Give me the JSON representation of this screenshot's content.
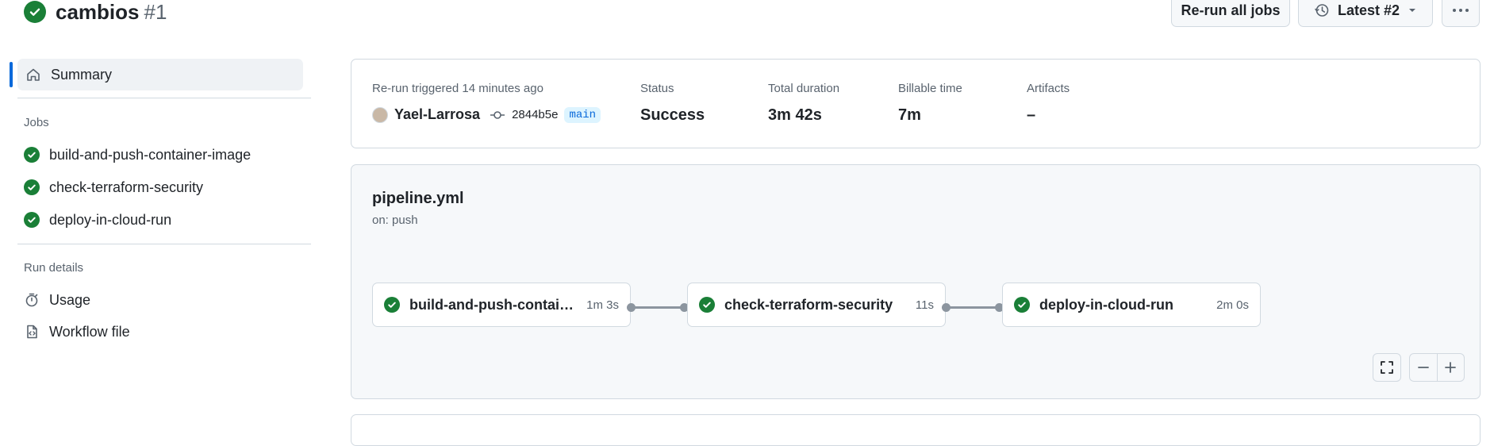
{
  "header": {
    "title": "cambios",
    "run_number": "#1",
    "rerun_label": "Re-run all jobs",
    "latest_label": "Latest #2"
  },
  "sidebar": {
    "summary_label": "Summary",
    "jobs_heading": "Jobs",
    "jobs": [
      {
        "label": "build-and-push-container-image"
      },
      {
        "label": "check-terraform-security"
      },
      {
        "label": "deploy-in-cloud-run"
      }
    ],
    "details_heading": "Run details",
    "details": [
      {
        "label": "Usage",
        "icon": "stopwatch-icon"
      },
      {
        "label": "Workflow file",
        "icon": "file-icon"
      }
    ]
  },
  "summary": {
    "trigger_label": "Re-run triggered 14 minutes ago",
    "user": "Yael-Larrosa",
    "commit": "2844b5e",
    "branch": "main",
    "status_label": "Status",
    "status_value": "Success",
    "duration_label": "Total duration",
    "duration_value": "3m 42s",
    "billable_label": "Billable time",
    "billable_value": "7m",
    "artifacts_label": "Artifacts",
    "artifacts_value": "–"
  },
  "workflow": {
    "file": "pipeline.yml",
    "trigger": "on: push",
    "jobs": [
      {
        "name": "build-and-push-container...",
        "duration": "1m 3s"
      },
      {
        "name": "check-terraform-security",
        "duration": "11s"
      },
      {
        "name": "deploy-in-cloud-run",
        "duration": "2m 0s"
      }
    ]
  },
  "colors": {
    "success": "#1a7f37",
    "accent": "#0969da",
    "border": "#d1d9e0",
    "muted": "#59636e"
  }
}
